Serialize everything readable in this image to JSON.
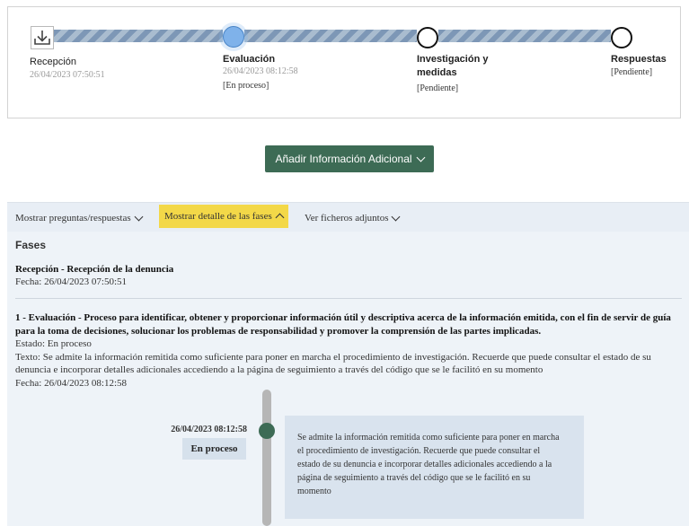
{
  "stepper": {
    "steps": [
      {
        "title": "Recepción",
        "date": "26/04/2023 07:50:51",
        "status": "",
        "icon": "download-icon"
      },
      {
        "title": "Evaluación",
        "date": "26/04/2023 08:12:58",
        "status": "[En proceso]",
        "icon": "active-circle"
      },
      {
        "title": "Investigación y medidas",
        "date": "",
        "status": "[Pendiente]",
        "icon": "empty-circle"
      },
      {
        "title": "Respuestas",
        "date": "",
        "status": "[Pendiente]",
        "icon": "empty-circle"
      }
    ]
  },
  "add_button": {
    "label": "Añadir Información Adicional"
  },
  "tabs": [
    {
      "label": "Mostrar preguntas/respuestas",
      "active": false
    },
    {
      "label": "Mostrar detalle de las fases",
      "active": true
    },
    {
      "label": "Ver ficheros adjuntos",
      "active": false
    }
  ],
  "fases": {
    "heading": "Fases",
    "reception": {
      "title": "Recepción - Recepción de la denuncia",
      "date": "Fecha: 26/04/2023 07:50:51"
    },
    "evaluation": {
      "title": "1 - Evaluación - Proceso para identificar, obtener y proporcionar información útil y descriptiva acerca de la información emitida, con el fin de servir de guía para la toma de decisiones, solucionar los problemas de responsabilidad y promover la comprensión de las partes implicadas.",
      "state": "Estado: En proceso",
      "text": "Texto: Se admite la información remitida como suficiente para poner en marcha el procedimiento de investigación. Recuerde que puede consultar el estado de su denuncia e incorporar detalles adicionales accediendo a la página de seguimiento a través del código que se le facilitó en su momento",
      "date": "Fecha: 26/04/2023 08:12:58"
    }
  },
  "timeline": {
    "date": "26/04/2023 08:12:58",
    "status": "En proceso",
    "message": "Se admite la información remitida como suficiente para poner en marcha el procedimiento de investigación. Recuerde que puede consultar el estado de su denuncia e incorporar detalles adicionales accediendo a la página de seguimiento a través del código que se le facilitó en su momento"
  },
  "colors": {
    "accent_green": "#3d6b55",
    "active_tab": "#f3d848",
    "active_step": "#7fb2ea"
  }
}
